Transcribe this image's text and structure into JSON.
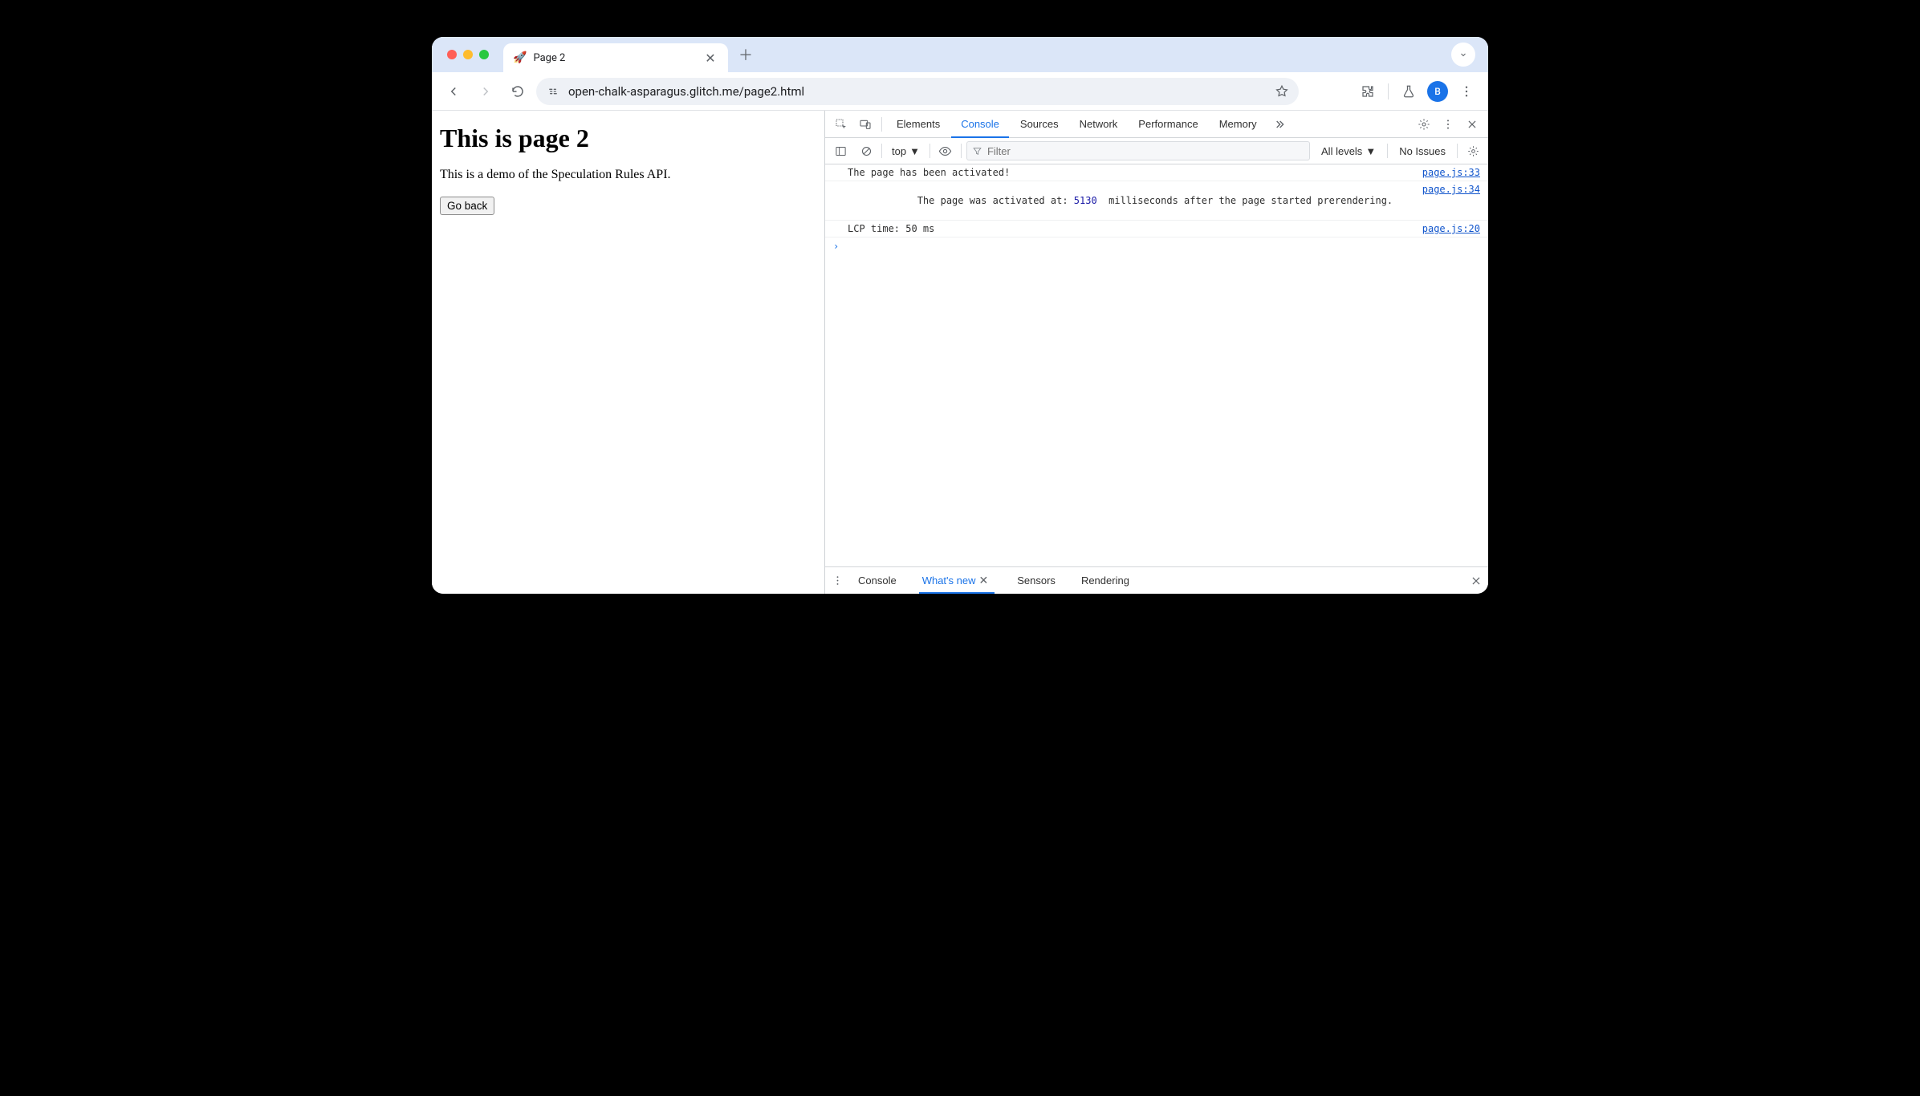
{
  "browser": {
    "tab_title": "Page 2",
    "favicon": "🚀",
    "url": "open-chalk-asparagus.glitch.me/page2.html",
    "avatar_letter": "B"
  },
  "page": {
    "heading": "This is page 2",
    "paragraph": "This is a demo of the Speculation Rules API.",
    "button": "Go back"
  },
  "devtools": {
    "tabs": [
      "Elements",
      "Console",
      "Sources",
      "Network",
      "Performance",
      "Memory"
    ],
    "active_tab": "Console",
    "context_label": "top",
    "filter_placeholder": "Filter",
    "levels_label": "All levels",
    "issues_label": "No Issues",
    "log": [
      {
        "text_before": "The page has been activated!",
        "number": "",
        "text_after": "",
        "src": "page.js:33"
      },
      {
        "text_before": "The page was activated at: ",
        "number": "5130",
        "text_after": "  milliseconds after the page started prerendering.",
        "src": "page.js:34"
      },
      {
        "text_before": "LCP time: 50 ms",
        "number": "",
        "text_after": "",
        "src": "page.js:20"
      }
    ],
    "drawer_tabs": [
      "Console",
      "What's new",
      "Sensors",
      "Rendering"
    ],
    "drawer_active": "What's new"
  }
}
